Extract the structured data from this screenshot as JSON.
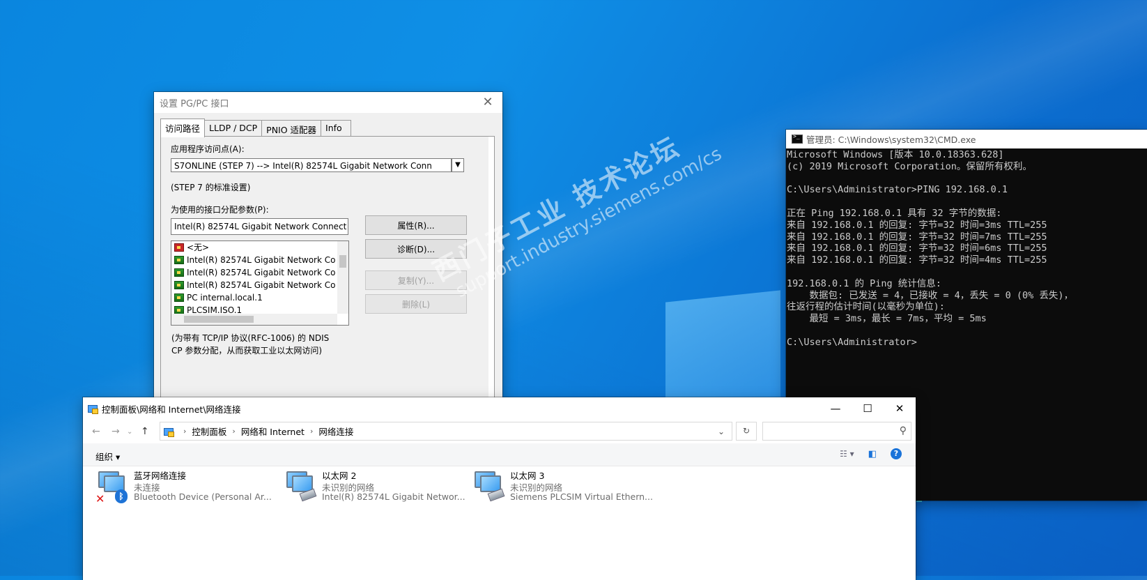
{
  "watermark": {
    "line1": "西门子工业 技术论坛",
    "line2": "support.industry.siemens.com/cs"
  },
  "pgpc_dialog": {
    "title": "设置 PG/PC 接口",
    "tabs": [
      "访问路径",
      "LLDP / DCP",
      "PNIO 适配器",
      "Info"
    ],
    "access_point_label": "应用程序访问点(A):",
    "access_point_value": "S7ONLINE (STEP 7)      --> Intel(R) 82574L Gigabit Network Conn",
    "access_point_desc": "(STEP 7 的标准设置)",
    "param_label": "为使用的接口分配参数(P):",
    "param_value": "Intel(R) 82574L Gigabit Network Connect",
    "list_items": [
      "<无>",
      "Intel(R) 82574L Gigabit Network Co",
      "Intel(R) 82574L Gigabit Network Co",
      "Intel(R) 82574L Gigabit Network Co",
      "PC internal.local.1",
      "PLCSIM.ISO.1"
    ],
    "buttons": {
      "properties": "属性(R)...",
      "diagnostics": "诊断(D)...",
      "copy": "复制(Y)...",
      "delete": "删除(L)"
    },
    "note_line1": "(为带有 TCP/IP 协议(RFC-1006) 的 NDIS",
    "note_line2": "CP 参数分配，从而获取工业以太网访问)"
  },
  "cmd": {
    "title": "管理员: C:\\Windows\\system32\\CMD.exe",
    "lines": [
      "Microsoft Windows [版本 10.0.18363.628]",
      "(c) 2019 Microsoft Corporation。保留所有权利。",
      "",
      "C:\\Users\\Administrator>PING 192.168.0.1",
      "",
      "正在 Ping 192.168.0.1 具有 32 字节的数据:",
      "来自 192.168.0.1 的回复: 字节=32 时间=3ms TTL=255",
      "来自 192.168.0.1 的回复: 字节=32 时间=7ms TTL=255",
      "来自 192.168.0.1 的回复: 字节=32 时间=6ms TTL=255",
      "来自 192.168.0.1 的回复: 字节=32 时间=4ms TTL=255",
      "",
      "192.168.0.1 的 Ping 统计信息:",
      "    数据包: 已发送 = 4，已接收 = 4，丢失 = 0 (0% 丢失)，",
      "往返行程的估计时间(以毫秒为单位):",
      "    最短 = 3ms，最长 = 7ms，平均 = 5ms",
      "",
      "C:\\Users\\Administrator>"
    ]
  },
  "explorer": {
    "title": "控制面板\\网络和 Internet\\网络连接",
    "breadcrumb": [
      "控制面板",
      "网络和 Internet",
      "网络连接"
    ],
    "organize": "组织",
    "items": [
      {
        "name": "蓝牙网络连接",
        "status": "未连接",
        "device": "Bluetooth Device (Personal Ar..."
      },
      {
        "name": "以太网 2",
        "status": "未识别的网络",
        "device": "Intel(R) 82574L Gigabit Networ..."
      },
      {
        "name": "以太网 3",
        "status": "未识别的网络",
        "device": "Siemens PLCSIM Virtual Ethern..."
      }
    ]
  }
}
